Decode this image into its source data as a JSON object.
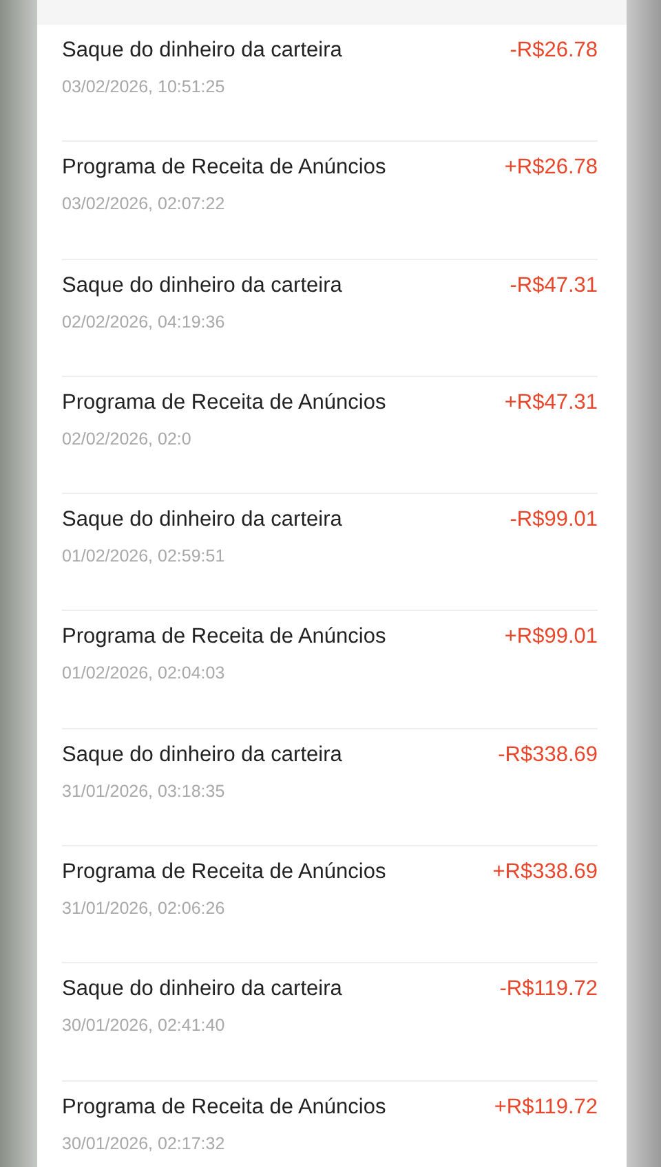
{
  "transactions": [
    {
      "title": "Saque do dinheiro da carteira",
      "date": "03/02/2026, 10:51:25",
      "amount": "-R$26.78"
    },
    {
      "title": "Programa de Receita de Anúncios",
      "date": "03/02/2026, 02:07:22",
      "amount": "+R$26.78"
    },
    {
      "title": "Saque do dinheiro da carteira",
      "date": "02/02/2026, 04:19:36",
      "amount": "-R$47.31"
    },
    {
      "title": "Programa de Receita de Anúncios",
      "date": "02/02/2026, 02:0",
      "amount": "+R$47.31"
    },
    {
      "title": "Saque do dinheiro da carteira",
      "date": "01/02/2026, 02:59:51",
      "amount": "-R$99.01"
    },
    {
      "title": "Programa de Receita de Anúncios",
      "date": "01/02/2026, 02:04:03",
      "amount": "+R$99.01"
    },
    {
      "title": "Saque do dinheiro da carteira",
      "date": "31/01/2026, 03:18:35",
      "amount": "-R$338.69"
    },
    {
      "title": "Programa de Receita de Anúncios",
      "date": "31/01/2026, 02:06:26",
      "amount": "+R$338.69"
    },
    {
      "title": "Saque do dinheiro da carteira",
      "date": "30/01/2026, 02:41:40",
      "amount": "-R$119.72"
    },
    {
      "title": "Programa de Receita de Anúncios",
      "date": "30/01/2026, 02:17:32",
      "amount": "+R$119.72"
    }
  ]
}
